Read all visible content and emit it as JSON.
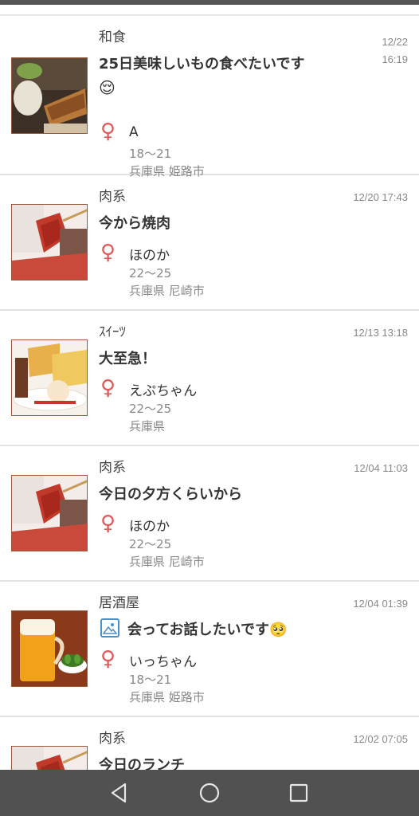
{
  "posts": [
    {
      "category": "和食",
      "title": "25日美味しいもの食べたいです",
      "emoji": "😌",
      "date": "12/22",
      "time": "16:19",
      "name": "A",
      "age": "18〜21",
      "location": "兵庫県 姫路市",
      "thumb": "washoku"
    },
    {
      "category": "肉系",
      "title": "今から焼肉",
      "date": "12/20 17:43",
      "name": "ほのか",
      "age": "22〜25",
      "location": "兵庫県 尼崎市",
      "thumb": "meat"
    },
    {
      "category": "ｽｲｰﾂ",
      "title": "大至急！",
      "date": "12/13 13:18",
      "name": "えぷちゃん",
      "age": "22〜25",
      "location": "兵庫県",
      "thumb": "sweets"
    },
    {
      "category": "肉系",
      "title": "今日の夕方くらいから",
      "date": "12/04 11:03",
      "name": "ほのか",
      "age": "22〜25",
      "location": "兵庫県 尼崎市",
      "thumb": "meat"
    },
    {
      "category": "居酒屋",
      "title": "会ってお話したいです🥺",
      "date": "12/04 01:39",
      "name": "いっちゃん",
      "age": "18〜21",
      "location": "兵庫県 姫路市",
      "thumb": "izakaya",
      "has_photo_icon": true
    },
    {
      "category": "肉系",
      "title": "今日のランチ",
      "date": "12/02 07:05",
      "thumb": "meat"
    }
  ],
  "gender_symbol": "♀",
  "icons": {
    "gender": "female-icon",
    "photo": "image-icon",
    "nav_back": "triangle-back-icon",
    "nav_home": "circle-home-icon",
    "nav_recent": "square-recent-icon"
  },
  "colors": {
    "gender": "#e05a5a",
    "date": "#888888",
    "navbar": "#515151"
  }
}
